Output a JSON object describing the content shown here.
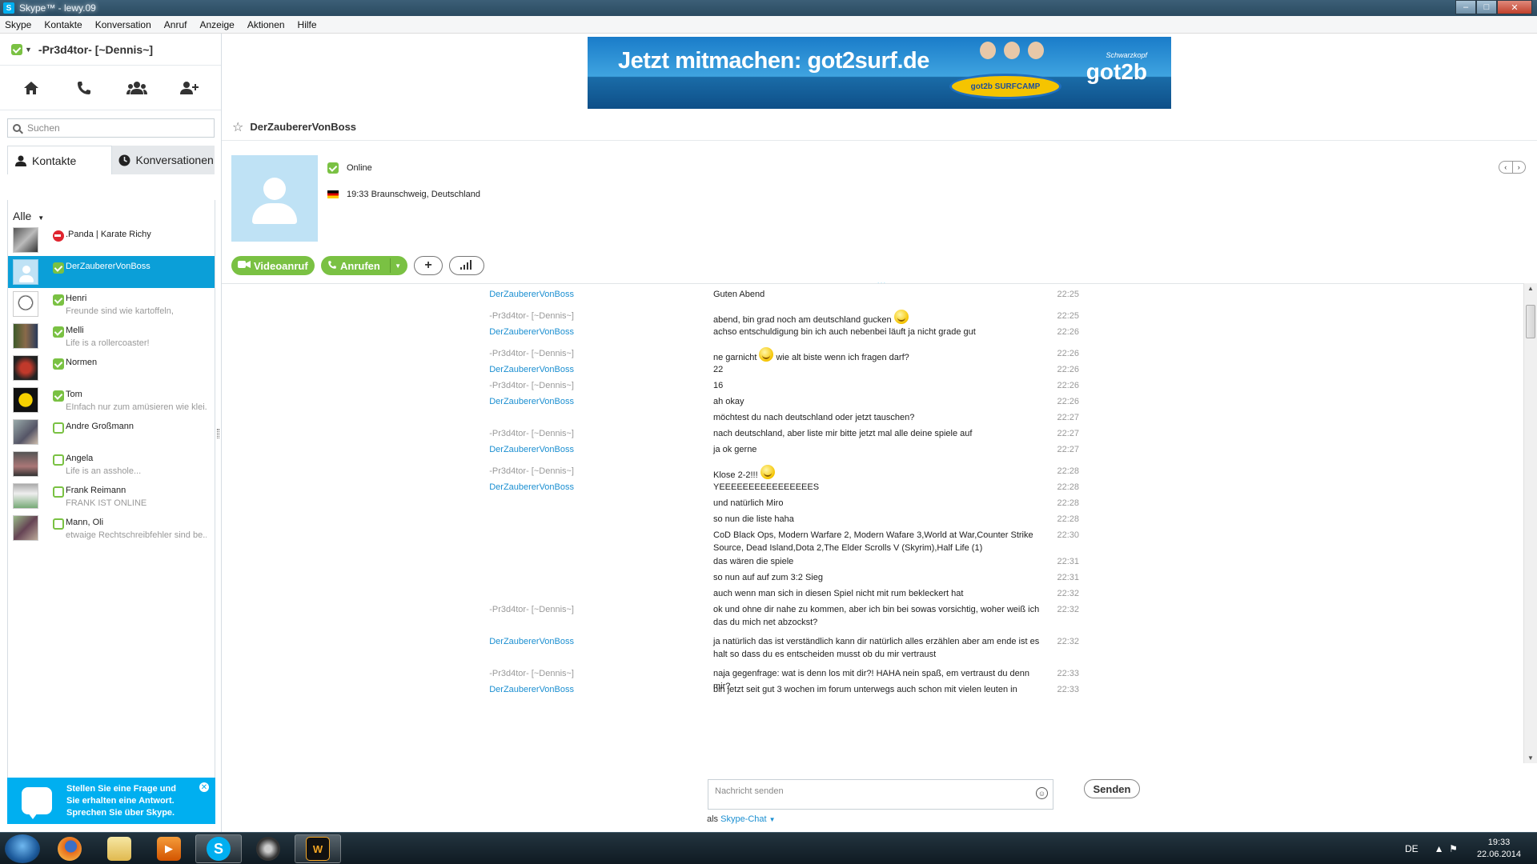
{
  "window": {
    "title": "Skype™ - lewy.09",
    "app_icon": "S"
  },
  "menu": [
    "Skype",
    "Kontakte",
    "Konversation",
    "Anruf",
    "Anzeige",
    "Aktionen",
    "Hilfe"
  ],
  "profile": {
    "name": "-Pr3d4tor- [~Dennis~]"
  },
  "search": {
    "placeholder": "Suchen"
  },
  "tabs": {
    "contacts": "Kontakte",
    "conversations": "Konversationen"
  },
  "filter": {
    "label": "Alle"
  },
  "contacts": [
    {
      "name": ".Panda | Karate Richy",
      "mood": "",
      "status": "busy"
    },
    {
      "name": "DerZaubererVonBoss",
      "mood": "",
      "status": "online"
    },
    {
      "name": "Henri",
      "mood": "Freunde sind wie kartoffeln,",
      "status": "online"
    },
    {
      "name": "Melli",
      "mood": "Life is a rollercoaster!",
      "status": "online"
    },
    {
      "name": "Normen",
      "mood": "",
      "status": "online"
    },
    {
      "name": "Tom",
      "mood": "EInfach nur zum amüsieren wie klei...",
      "status": "online"
    },
    {
      "name": "Andre Großmann",
      "mood": "",
      "status": "offline"
    },
    {
      "name": "Angela",
      "mood": "Life is an asshole...",
      "status": "offline"
    },
    {
      "name": "Frank Reimann",
      "mood": "FRANK IST ONLINE",
      "status": "offline"
    },
    {
      "name": "Mann, Oli",
      "mood": "etwaige Rechtschreibfehler sind be...",
      "status": "offline"
    }
  ],
  "promo": {
    "text": "Stellen Sie eine Frage und Sie erhalten eine Antwort. Sprechen Sie über Skype."
  },
  "ad": {
    "headline": "Jetzt mitmachen: got2surf.de",
    "brand": "got2b",
    "brand_sub": "Schwarzkopf",
    "board": "got2b SURFCAMP"
  },
  "chat": {
    "contact_name": "DerZaubererVonBoss",
    "status": "Online",
    "location": "19:33 Braunschweig, Deutschland",
    "video_button": "Videoanruf",
    "call_button": "Anrufen"
  },
  "messages": [
    {
      "sender": "DerZaubererVonBoss",
      "who": "them",
      "text": "Guten Abend",
      "time": "22:25"
    },
    {
      "sender": "-Pr3d4tor- [~Dennis~]",
      "who": "me",
      "text": "abend, bin grad noch am deutschland gucken",
      "time": "22:25",
      "smiley": true
    },
    {
      "sender": "DerZaubererVonBoss",
      "who": "them",
      "text": "achso entschuldigung bin ich auch nebenbei läuft ja nicht grade gut",
      "time": "22:26"
    },
    {
      "sender": "-Pr3d4tor- [~Dennis~]",
      "who": "me",
      "text": "ne garnicht",
      "text2": "wie alt biste wenn ich fragen darf?",
      "time": "22:26",
      "smiley": true
    },
    {
      "sender": "DerZaubererVonBoss",
      "who": "them",
      "text": "22",
      "time": "22:26"
    },
    {
      "sender": "-Pr3d4tor- [~Dennis~]",
      "who": "me",
      "text": "16",
      "time": "22:26"
    },
    {
      "sender": "DerZaubererVonBoss",
      "who": "them",
      "text": "ah okay",
      "time": "22:26"
    },
    {
      "sender": "",
      "who": "them",
      "text": "möchtest du nach deutschland oder jetzt tauschen?",
      "time": "22:27"
    },
    {
      "sender": "-Pr3d4tor- [~Dennis~]",
      "who": "me",
      "text": "nach deutschland, aber liste mir bitte jetzt mal alle deine spiele auf",
      "time": "22:27"
    },
    {
      "sender": "DerZaubererVonBoss",
      "who": "them",
      "text": "ja ok gerne",
      "time": "22:27"
    },
    {
      "sender": "-Pr3d4tor- [~Dennis~]",
      "who": "me",
      "text": "Klose 2-2!!!",
      "time": "22:28",
      "smiley": true
    },
    {
      "sender": "DerZaubererVonBoss",
      "who": "them",
      "text": "YEEEEEEEEEEEEEEEES",
      "time": "22:28"
    },
    {
      "sender": "",
      "who": "them",
      "text": "und natürlich Miro",
      "time": "22:28"
    },
    {
      "sender": "",
      "who": "them",
      "text": "so nun die liste haha",
      "time": "22:28"
    },
    {
      "sender": "",
      "who": "them",
      "text": "CoD Black Ops, Modern Warfare 2, Modern Wafare 3,World at War,Counter Strike Source, Dead Island,Dota 2,The Elder Scrolls V (Skyrim),Half Life (1)",
      "time": "22:30"
    },
    {
      "sender": "",
      "who": "them",
      "text": "das wären die spiele",
      "time": "22:31"
    },
    {
      "sender": "",
      "who": "them",
      "text": "so nun auf auf zum 3:2 Sieg",
      "time": "22:31"
    },
    {
      "sender": "",
      "who": "them",
      "text": "auch wenn man sich in diesen Spiel nicht mit rum bekleckert hat",
      "time": "22:32"
    },
    {
      "sender": "-Pr3d4tor- [~Dennis~]",
      "who": "me",
      "text": "ok und ohne dir nahe zu kommen, aber ich bin bei sowas vorsichtig, woher weiß ich das du mich net abzockst?",
      "time": "22:32"
    },
    {
      "sender": "DerZaubererVonBoss",
      "who": "them",
      "text": "ja natürlich das ist verständlich kann dir natürlich alles erzählen aber am ende ist es halt so dass du es entscheiden musst ob du mir vertraust",
      "time": "22:32"
    },
    {
      "sender": "-Pr3d4tor- [~Dennis~]",
      "who": "me",
      "text": "naja gegenfrage: wat is denn los mit dir?! HAHA nein spaß, em vertraust du denn mir?",
      "time": "22:33"
    },
    {
      "sender": "DerZaubererVonBoss",
      "who": "them",
      "text": "bin jetzt seit gut 3 wochen im forum unterwegs auch schon mit vielen leuten in",
      "time": "22:33"
    }
  ],
  "composer": {
    "placeholder": "Nachricht senden",
    "send": "Senden",
    "via_prefix": "als",
    "via_link": "Skype-Chat"
  },
  "taskbar": {
    "lang": "DE",
    "time": "19:33",
    "date": "22.06.2014"
  },
  "colors": {
    "skype_blue": "#00aff0",
    "online_green": "#7ac143",
    "link_blue": "#1b8fd1"
  }
}
